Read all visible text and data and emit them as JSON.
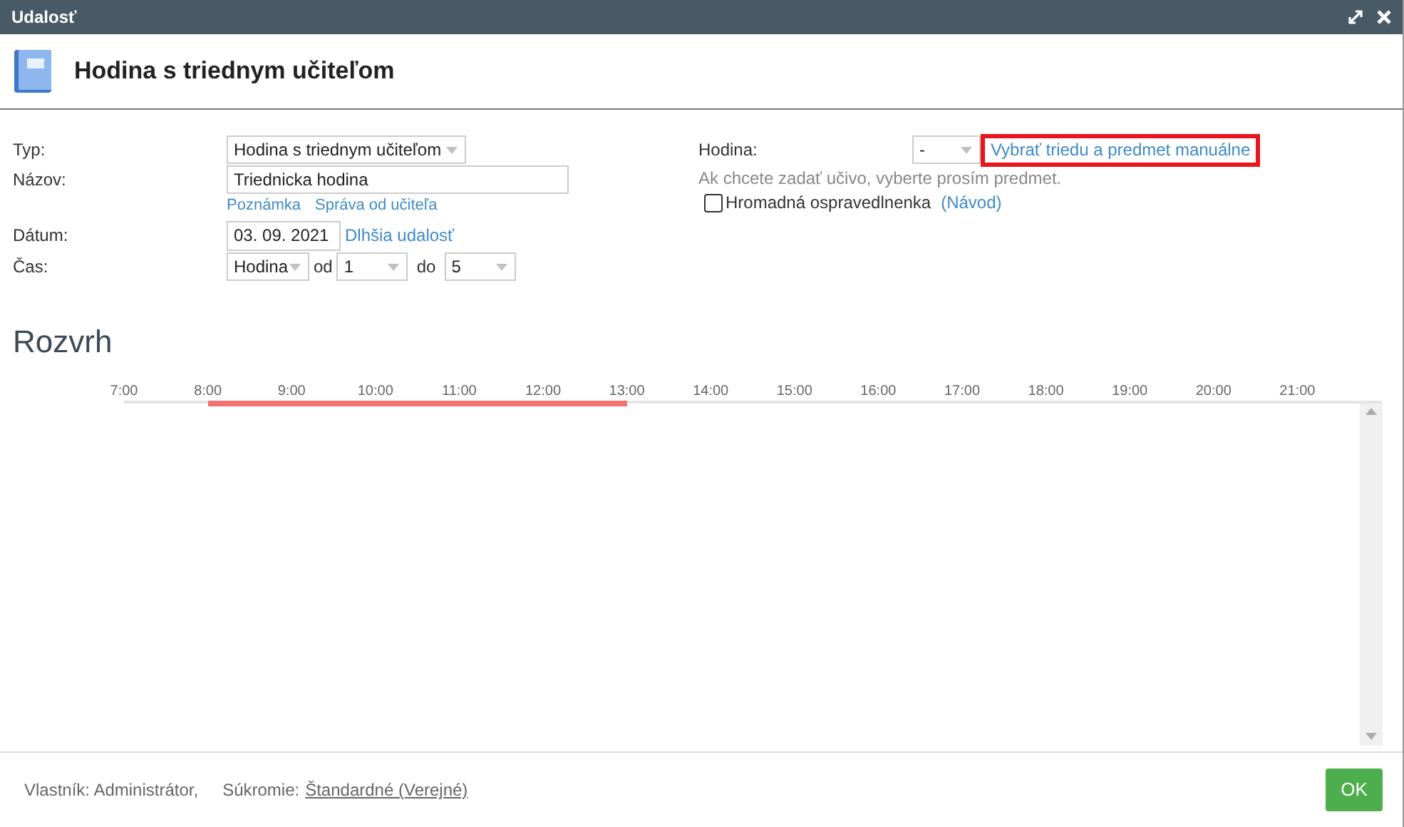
{
  "window": {
    "title": "Udalosť"
  },
  "header": {
    "title": "Hodina s triednym učiteľom"
  },
  "form": {
    "type": {
      "label": "Typ:",
      "value": "Hodina s triednym učiteľom"
    },
    "name": {
      "label": "Názov:",
      "value": "Triednicka hodina"
    },
    "name_links": [
      "Poznámka",
      "Správa od učiteľa"
    ],
    "date": {
      "label": "Dátum:",
      "value": "03. 09. 2021",
      "link": "Dlhšia udalosť"
    },
    "time": {
      "label": "Čas:",
      "unit": "Hodina",
      "from_label": "od",
      "from": "1",
      "to_label": "do",
      "to": "5"
    },
    "lesson": {
      "label": "Hodina:",
      "value": "-",
      "link": "Vybrať triedu a predmet manuálne",
      "highlighted": true
    },
    "hint": "Ak chcete zadať učivo, vyberte prosím predmet.",
    "bulk_excuse": {
      "label": "Hromadná ospravedlnenka",
      "checked": false,
      "help": "(Návod)"
    }
  },
  "schedule": {
    "title": "Rozvrh",
    "hours": [
      {
        "label": "7:00",
        "in_event": false
      },
      {
        "label": "8:00",
        "in_event": true
      },
      {
        "label": "9:00",
        "in_event": true
      },
      {
        "label": "10:00",
        "in_event": true
      },
      {
        "label": "11:00",
        "in_event": true
      },
      {
        "label": "12:00",
        "in_event": true
      },
      {
        "label": "13:00",
        "in_event": false
      },
      {
        "label": "14:00",
        "in_event": false
      },
      {
        "label": "15:00",
        "in_event": false
      },
      {
        "label": "16:00",
        "in_event": false
      },
      {
        "label": "17:00",
        "in_event": false
      },
      {
        "label": "18:00",
        "in_event": false
      },
      {
        "label": "19:00",
        "in_event": false
      },
      {
        "label": "20:00",
        "in_event": false
      },
      {
        "label": "21:00",
        "in_event": false
      }
    ]
  },
  "footer": {
    "owner": "Vlastník: Administrátor,",
    "privacy_label": "Súkromie:",
    "privacy_value": "Štandardné (Verejné)",
    "ok": "OK"
  }
}
